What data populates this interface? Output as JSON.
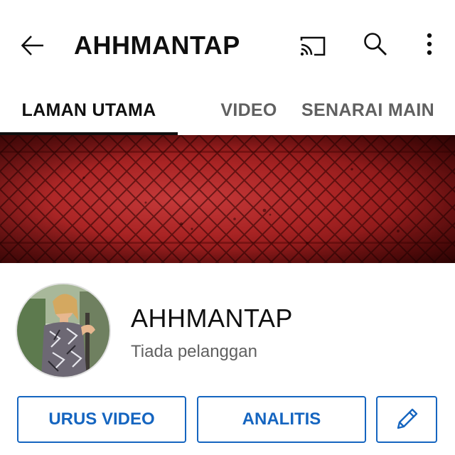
{
  "header": {
    "title": "AHHMANTAP",
    "icons": [
      "back-arrow-icon",
      "cast-icon",
      "search-icon",
      "more-vert-icon"
    ]
  },
  "tabs": [
    {
      "label": "LAMAN UTAMA",
      "active": true
    },
    {
      "label": "VIDEO",
      "active": false
    },
    {
      "label": "SENARAI MAIN",
      "active": false
    }
  ],
  "channel": {
    "name": "AHHMANTAP",
    "subscribers": "Tiada pelanggan"
  },
  "actions": {
    "manage_label": "URUS VIDEO",
    "analytics_label": "ANALITIS",
    "edit_icon": "pencil-icon"
  },
  "colors": {
    "accent": "#1565c0",
    "banner": "#a92424",
    "text_primary": "#0f0f0f",
    "text_secondary": "#606060"
  }
}
